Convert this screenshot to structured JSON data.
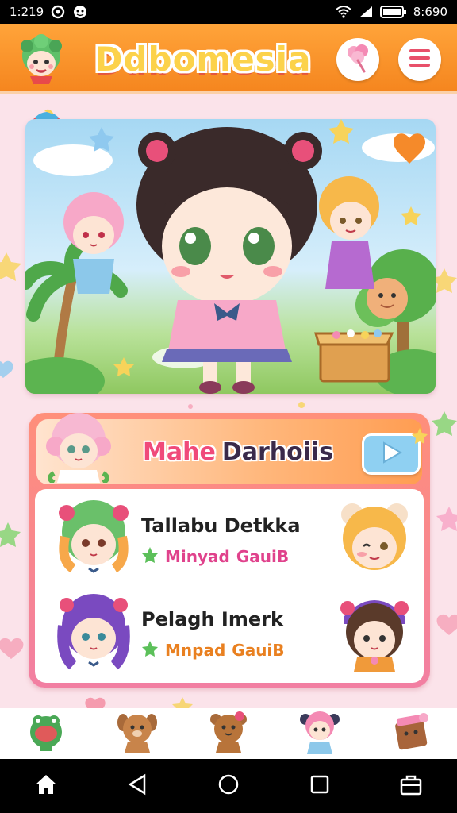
{
  "status_bar": {
    "time": "1:219",
    "battery_text": "8:690"
  },
  "header": {
    "app_title": "Ddbomesia",
    "candy_icon": "cotton-candy-icon",
    "menu_icon": "hamburger-menu-icon"
  },
  "featured": {
    "title_part1": "Mahe",
    "title_part2": "Darhoiis",
    "play_icon": "play-icon",
    "items": [
      {
        "name": "Tallabu Detkka",
        "sub_part1": "Minyad",
        "sub_part2": "GauiB"
      },
      {
        "name": "Pelagh Imerk",
        "sub_part1": "Mnpad",
        "sub_part2": "GauiB"
      }
    ]
  },
  "tab_bar": {
    "tabs": [
      "frog-character-icon",
      "dog-character-icon",
      "bear-character-icon",
      "girl-character-icon",
      "box-character-icon"
    ]
  },
  "nav_bar": {
    "buttons": [
      "home-icon",
      "back-icon",
      "circle-home-icon",
      "recents-icon",
      "briefcase-icon"
    ]
  },
  "colors": {
    "header_orange": "#f5861f",
    "title_yellow": "#fcd24a",
    "background_pink": "#fbe3ea",
    "accent_pink": "#f04a7a"
  }
}
